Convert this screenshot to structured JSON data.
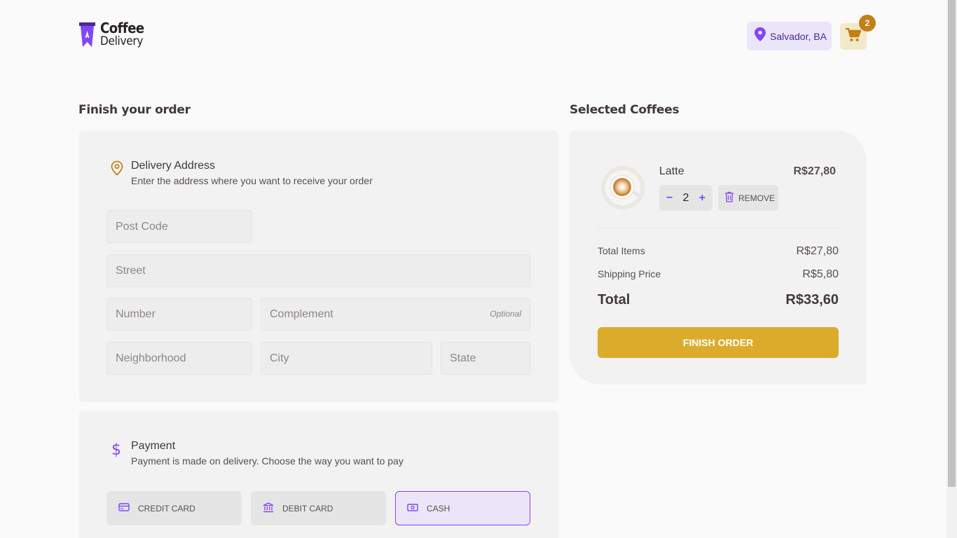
{
  "header": {
    "logo_line1": "Coffee",
    "logo_line2": "Delivery",
    "location": "Salvador, BA",
    "cart_count": "2"
  },
  "checkout": {
    "title": "Finish your order",
    "address": {
      "title": "Delivery Address",
      "subtitle": "Enter the address where you want to receive your order",
      "fields": {
        "post_code": "Post Code",
        "street": "Street",
        "number": "Number",
        "complement": "Complement",
        "complement_tag": "Optional",
        "neighborhood": "Neighborhood",
        "city": "City",
        "state": "State"
      }
    },
    "payment": {
      "title": "Payment",
      "subtitle": "Payment is made on delivery. Choose the way you want to pay",
      "options": [
        {
          "label": "CREDIT CARD",
          "selected": false
        },
        {
          "label": "DEBIT CARD",
          "selected": false
        },
        {
          "label": "CASH",
          "selected": true
        }
      ]
    }
  },
  "cart": {
    "title": "Selected Coffees",
    "items": [
      {
        "name": "Latte",
        "price": "R$27,80",
        "quantity": "2",
        "remove_label": "REMOVE"
      }
    ],
    "summary": {
      "total_items_label": "Total Items",
      "total_items_value": "R$27,80",
      "shipping_label": "Shipping Price",
      "shipping_value": "R$5,80",
      "total_label": "Total",
      "total_value": "R$33,60"
    },
    "finish_label": "FINISH ORDER"
  },
  "colors": {
    "purple": "#8047f8",
    "purple_dark": "#4b2995",
    "yellow": "#dbac2c",
    "yellow_dark": "#c47f17"
  }
}
